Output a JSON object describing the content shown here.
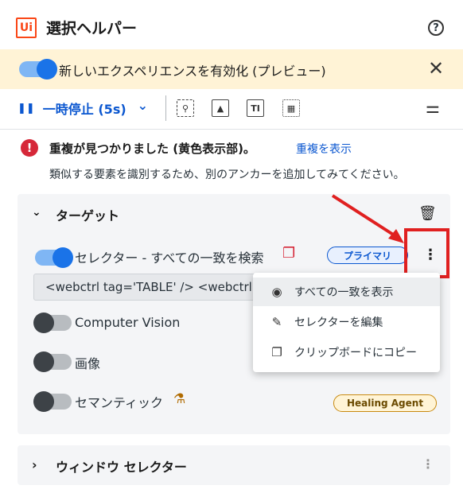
{
  "header": {
    "logo": "Ui",
    "title": "選択ヘルパー",
    "help": "?"
  },
  "banner": {
    "text": "新しいエクスペリエンスを有効化 (プレビュー)",
    "close": "✕"
  },
  "toolbar": {
    "pause_label": "一時停止 (5s)",
    "pause_glyph": "❚❚",
    "dropdown_glyph": "⌄"
  },
  "warning": {
    "icon": "!",
    "title": "重複が見つかりました (黄色表示部)。",
    "link": "重複を表示",
    "subtitle": "類似する要素を識別するため、別のアンカーを追加してみてください。"
  },
  "target": {
    "title": "ターゲット",
    "selector_label": "セレクター - すべての一致を検索",
    "primary_badge": "プライマリ",
    "selector_value": "<webctrl tag='TABLE' /> <webctrl",
    "computer_vision_label": "Computer Vision",
    "image_label": "画像",
    "semantic_label": "セマンティック",
    "healing_badge": "Healing Agent"
  },
  "menu": {
    "items": [
      {
        "label": "すべての一致を表示",
        "icon": "eye-icon"
      },
      {
        "label": "セレクターを編集",
        "icon": "edit-icon"
      },
      {
        "label": "クリップボードにコピー",
        "icon": "copy-icon"
      }
    ]
  },
  "window_selector": {
    "title": "ウィンドウ セレクター"
  },
  "colors": {
    "accent": "#0b57d0",
    "logo": "#fa4616",
    "error": "#d62839",
    "banner_bg": "#fff3d6",
    "highlight": "#e02020"
  }
}
